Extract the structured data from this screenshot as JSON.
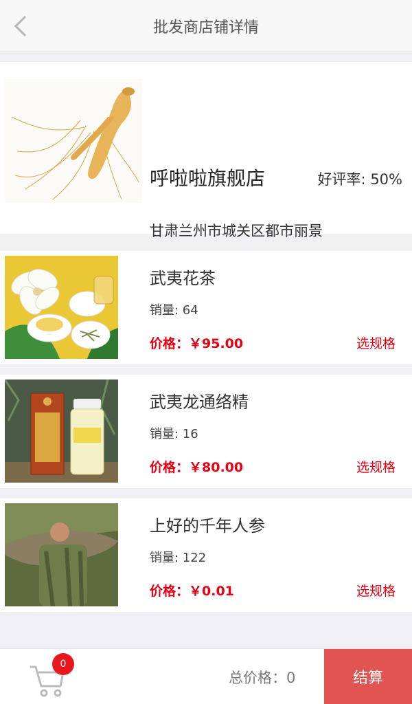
{
  "header": {
    "title": "批发商店铺详情"
  },
  "shop": {
    "name": "呼啦啦旗舰店",
    "rating": "好评率: 50%",
    "address": "甘肃兰州市城关区都市丽景"
  },
  "products": [
    {
      "name": "武夷花茶",
      "sales": "销量: 64",
      "price": "价格：￥95.00",
      "spec_label": "选规格"
    },
    {
      "name": "武夷龙通络精",
      "sales": "销量: 16",
      "price": "价格：￥80.00",
      "spec_label": "选规格"
    },
    {
      "name": "上好的千年人参",
      "sales": "销量: 122",
      "price": "价格：￥0.01",
      "spec_label": "选规格"
    }
  ],
  "footer": {
    "cart_count": "0",
    "total_label": "总价格：0",
    "checkout_label": "结算"
  },
  "colors": {
    "price_red": "#e60012",
    "checkout_bg": "#e15451",
    "badge_red": "#e8171e"
  }
}
